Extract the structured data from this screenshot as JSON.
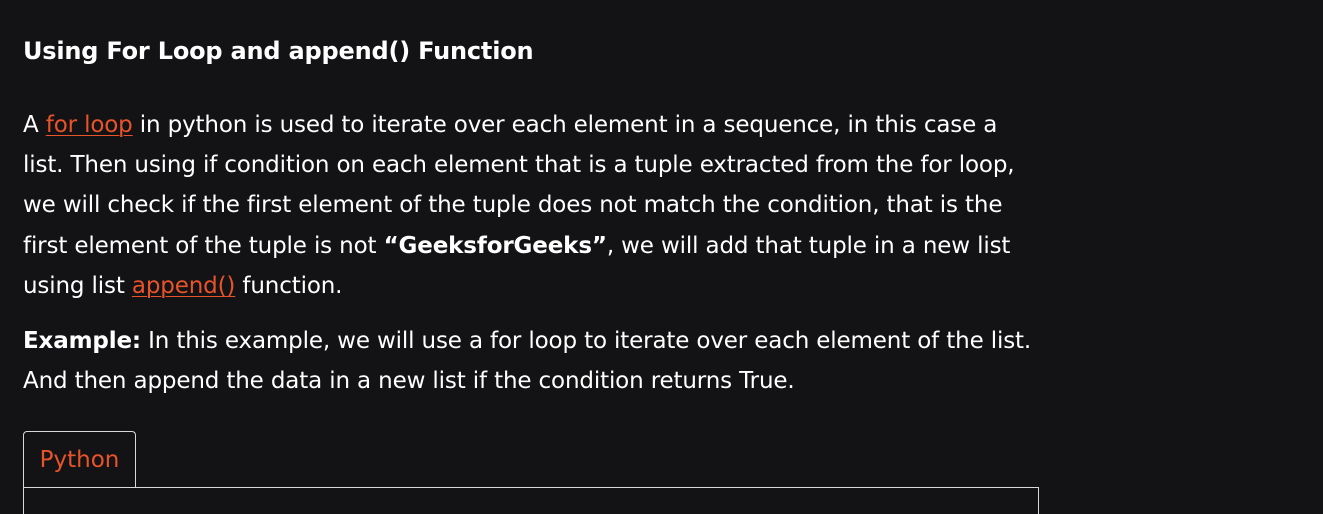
{
  "article": {
    "heading": "Using For Loop and append() Function",
    "paragraph": {
      "prefix": "A ",
      "link1": "for loop",
      "text1": " in python is used to iterate over each element in a sequence, in this case a list. Then using if condition on each element that is a tuple extracted from the for loop, we will check if the first element of the tuple does not match the condition, that is the first element of the tuple is not ",
      "bold": "“GeeksforGeeks”",
      "text2": ", we will add that tuple in a new list using list ",
      "link2": "append()",
      "text3": " function."
    },
    "example": {
      "label": "Example:",
      "text": " In this example, we will use a for loop to iterate over each element of the list. And then append the data in a new list if the condition returns True."
    }
  },
  "code_block": {
    "tab_label": "Python"
  },
  "colors": {
    "background": "#131316",
    "text": "#ffffff",
    "link": "#e8532a",
    "border": "#d8d8d8"
  }
}
